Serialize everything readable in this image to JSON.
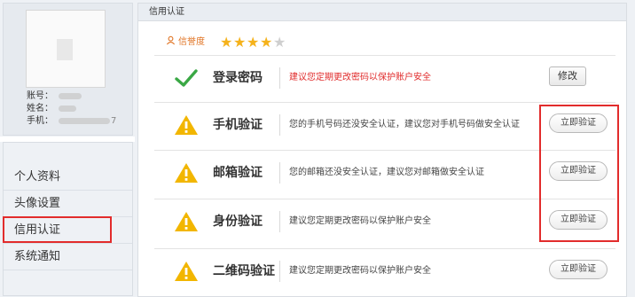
{
  "profile": {
    "account_label": "账号：",
    "name_label": "姓名：",
    "phone_label": "手机：",
    "phone_tail": "7"
  },
  "menu": {
    "items": [
      {
        "label": "个人资料"
      },
      {
        "label": "头像设置"
      },
      {
        "label": "信用认证"
      },
      {
        "label": "系统通知"
      }
    ],
    "active_index": 2
  },
  "panel": {
    "title": "信用认证",
    "credit_label": "信誉度",
    "rating": 4,
    "rating_max": 5
  },
  "rows": [
    {
      "icon": "check-icon",
      "title": "登录密码",
      "desc": "建议您定期更改密码以保护账户安全",
      "desc_style": "warn",
      "button": "修改"
    },
    {
      "icon": "warning-icon",
      "title": "手机验证",
      "desc": "您的手机号码还没安全认证，建议您对手机号码做安全认证",
      "button": "立即验证"
    },
    {
      "icon": "warning-icon",
      "title": "邮箱验证",
      "desc": "您的邮箱还没安全认证，建议您对邮箱做安全认证",
      "button": "立即验证"
    },
    {
      "icon": "warning-icon",
      "title": "身份验证",
      "desc": "建议您定期更改密码以保护账户安全",
      "button": "立即验证"
    },
    {
      "icon": "warning-icon",
      "title": "二维码验证",
      "desc": "建议您定期更改密码以保护账户安全",
      "button": "立即验证"
    }
  ],
  "colors": {
    "accent_red": "#e22c2c",
    "star": "#f5b21b",
    "check": "#3aa845",
    "warning": "#f2b600",
    "credit_orange": "#e07424"
  }
}
